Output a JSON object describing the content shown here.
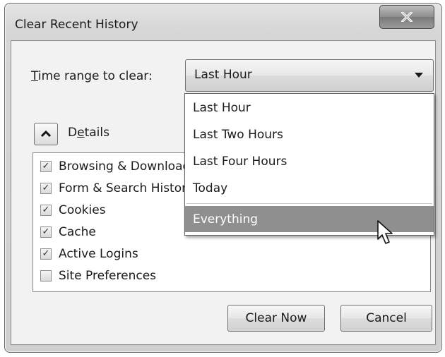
{
  "window": {
    "title": "Clear Recent History",
    "close_label": "x"
  },
  "time_range": {
    "label_prefix": "",
    "label_accel": "T",
    "label_rest": "ime range to clear:",
    "selected": "Last Hour",
    "options": [
      "Last Hour",
      "Last Two Hours",
      "Last Four Hours",
      "Today",
      "Everything"
    ],
    "highlighted_option": "Everything"
  },
  "details": {
    "label_pre": "D",
    "label_accel": "e",
    "label_rest": "tails",
    "expanded": true
  },
  "items": [
    {
      "label": "Browsing & Download History",
      "checked": true
    },
    {
      "label": "Form & Search History",
      "checked": true
    },
    {
      "label": "Cookies",
      "checked": true
    },
    {
      "label": "Cache",
      "checked": true
    },
    {
      "label": "Active Logins",
      "checked": true
    },
    {
      "label": "Site Preferences",
      "checked": false
    }
  ],
  "buttons": {
    "clear_now": "Clear Now",
    "cancel": "Cancel"
  },
  "icons": {
    "close": "close-icon",
    "dropdown": "chevron-down-icon",
    "details_toggle": "chevron-up-icon",
    "check": "checkmark-icon",
    "cursor": "mouse-pointer-icon"
  }
}
